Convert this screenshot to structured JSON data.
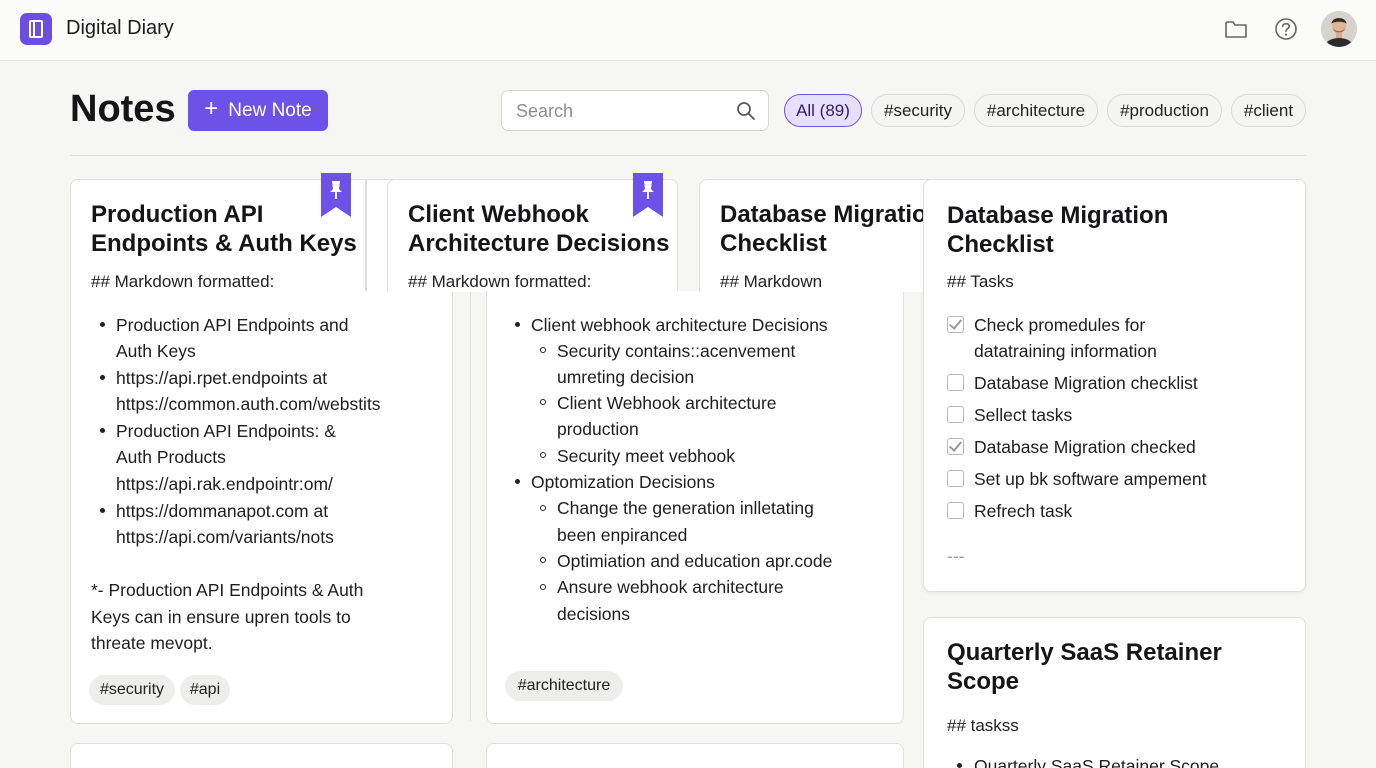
{
  "app": {
    "title": "Digital Diary"
  },
  "header_icons": [
    "folder-icon",
    "help-icon",
    "avatar"
  ],
  "colors": {
    "accent": "#6c52e6",
    "background": "#f6f6f5",
    "card": "#ffffff"
  },
  "page": {
    "title": "Notes",
    "new_note_label": "New Note"
  },
  "search": {
    "placeholder": "Search",
    "value": ""
  },
  "filters": [
    {
      "label": "All (89)",
      "active": true
    },
    {
      "label": "#security",
      "active": false
    },
    {
      "label": "#architecture",
      "active": false
    },
    {
      "label": "#production",
      "active": false
    },
    {
      "label": "#client",
      "active": false
    }
  ],
  "notes": [
    {
      "title_lines": [
        "Production API",
        "Endpoints & Auth Keys"
      ],
      "subtitle": "## Markdown formatted:",
      "pinned": true,
      "lines": [
        "Production API Endpoints and",
        "Auth Keys",
        "https://api.rpet.endpoints at",
        "https://common.auth.com/webstits",
        "Production API Endpoints: &",
        "Auth Products",
        "https://api.rak.endpointr:om/",
        "https://dommanapot.com at",
        "https://api.com/variants/nots"
      ],
      "note_lines": [
        "*- Production API Endpoints & Auth",
        "Keys can in ensure upren tools to",
        "threate mevopt."
      ],
      "tags": [
        "#security",
        "#api"
      ]
    },
    {
      "title_lines": [
        "Client Webhook",
        "Architecture Decisions"
      ],
      "subtitle": "## Markdown formatted:",
      "pinned": true,
      "lines": [
        "Client webhook architecture Decisions",
        "Security contains::acenvement",
        "umreting decision",
        "Client Webhook architecture",
        "production",
        "Security meet vebhook",
        "Optomization Decisions",
        "Change the generation inlletating",
        "been enpiranced",
        "Optimiation and education apr.code",
        "Ansure webhook architecture",
        "decisions"
      ],
      "tags": [
        "#architecture"
      ]
    },
    {
      "title_lines": [
        "Database Migration",
        "Checklist"
      ],
      "subtitle": "## Markdown",
      "pinned": false
    },
    {
      "title_lines": [
        "Database Migration",
        "Checklist"
      ],
      "subtitle": "## Tasks",
      "pinned": false,
      "tasks": [
        {
          "lines": [
            "Check promedules for",
            "datatraining information"
          ],
          "checked": true
        },
        {
          "lines": [
            "Database Migration checklist"
          ],
          "checked": false
        },
        {
          "lines": [
            "Sellect tasks"
          ],
          "checked": false
        },
        {
          "lines": [
            "Database Migration checked"
          ],
          "checked": true
        },
        {
          "lines": [
            "Set up bk software ampement"
          ],
          "checked": false
        },
        {
          "lines": [
            "Refrech task"
          ],
          "checked": false
        }
      ],
      "separator": "---"
    },
    {
      "title_lines": [
        "Quarterly SaaS Retainer",
        "Scope"
      ],
      "subtitle": "## taskss",
      "lines": [
        "Quarterly SaaS Retainer Scope"
      ]
    }
  ]
}
